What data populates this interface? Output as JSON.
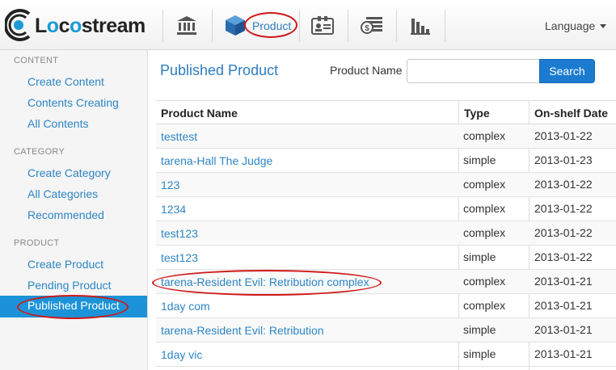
{
  "brand": {
    "name_prefix": "L",
    "name_o1": "o",
    "name_mid": "c",
    "name_o2": "o",
    "name_suffix": "stream"
  },
  "topnav": {
    "items": [
      {
        "icon": "bank-icon"
      },
      {
        "icon": "box-icon",
        "label": "Product"
      },
      {
        "icon": "id-card-icon"
      },
      {
        "icon": "money-icon"
      },
      {
        "icon": "bar-chart-icon"
      }
    ],
    "language_label": "Language"
  },
  "sidebar": {
    "sections": [
      {
        "title": "CONTENT",
        "items": [
          "Create Content",
          "Contents Creating",
          "All Contents"
        ]
      },
      {
        "title": "CATEGORY",
        "items": [
          "Create Category",
          "All Categories",
          "Recommended"
        ]
      },
      {
        "title": "PRODUCT",
        "items": [
          "Create Product",
          "Pending Product",
          "Published Product"
        ]
      }
    ],
    "active_item": "Published Product"
  },
  "main": {
    "title": "Published Product",
    "search": {
      "label": "Product Name",
      "value": "",
      "placeholder": "",
      "button": "Search"
    },
    "table": {
      "columns": [
        "Product Name",
        "Type",
        "On-shelf Date"
      ],
      "rows": [
        [
          "testtest",
          "complex",
          "2013-01-22"
        ],
        [
          "tarena-Hall The Judge",
          "simple",
          "2013-01-23"
        ],
        [
          "123",
          "complex",
          "2013-01-22"
        ],
        [
          "1234",
          "complex",
          "2013-01-22"
        ],
        [
          "test123",
          "complex",
          "2013-01-22"
        ],
        [
          "test123",
          "simple",
          "2013-01-22"
        ],
        [
          "tarena-Resident Evil: Retribution complex",
          "complex",
          "2013-01-21"
        ],
        [
          "1day com",
          "complex",
          "2013-01-21"
        ],
        [
          "tarena-Resident Evil: Retribution",
          "simple",
          "2013-01-21"
        ],
        [
          "1day vic",
          "simple",
          "2013-01-21"
        ]
      ]
    }
  },
  "colors": {
    "accent": "#1c93d8",
    "link": "#2d86c5",
    "annotation": "#d01818"
  }
}
